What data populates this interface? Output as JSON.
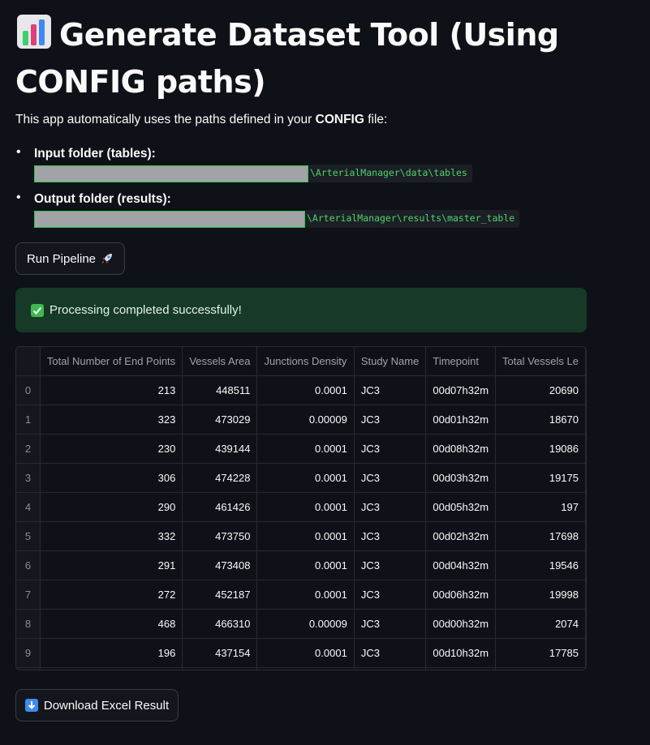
{
  "title": "Generate Dataset Tool (Using CONFIG paths)",
  "intro": {
    "prefix": "This app automatically uses the paths defined in your ",
    "bold": "CONFIG",
    "suffix": " file:"
  },
  "paths": [
    {
      "label": "Input folder (tables):",
      "suffix": "\\ArterialManager\\data\\tables"
    },
    {
      "label": "Output folder (results):",
      "suffix": "\\ArterialManager\\results\\master_table"
    }
  ],
  "run_button": "Run Pipeline",
  "success_message": "Processing completed successfully!",
  "table": {
    "columns": [
      "Total Number of End Points",
      "Vessels Area",
      "Junctions Density",
      "Study Name",
      "Timepoint",
      "Total Vessels Le"
    ],
    "rows": [
      {
        "idx": "0",
        "end_points": "213",
        "area": "448511",
        "density": "0.0001",
        "study": "JC3",
        "timepoint": "00d07h32m",
        "length": "20690"
      },
      {
        "idx": "1",
        "end_points": "323",
        "area": "473029",
        "density": "0.00009",
        "study": "JC3",
        "timepoint": "00d01h32m",
        "length": "18670"
      },
      {
        "idx": "2",
        "end_points": "230",
        "area": "439144",
        "density": "0.0001",
        "study": "JC3",
        "timepoint": "00d08h32m",
        "length": "19086"
      },
      {
        "idx": "3",
        "end_points": "306",
        "area": "474228",
        "density": "0.0001",
        "study": "JC3",
        "timepoint": "00d03h32m",
        "length": "19175"
      },
      {
        "idx": "4",
        "end_points": "290",
        "area": "461426",
        "density": "0.0001",
        "study": "JC3",
        "timepoint": "00d05h32m",
        "length": "197"
      },
      {
        "idx": "5",
        "end_points": "332",
        "area": "473750",
        "density": "0.0001",
        "study": "JC3",
        "timepoint": "00d02h32m",
        "length": "17698"
      },
      {
        "idx": "6",
        "end_points": "291",
        "area": "473408",
        "density": "0.0001",
        "study": "JC3",
        "timepoint": "00d04h32m",
        "length": "19546"
      },
      {
        "idx": "7",
        "end_points": "272",
        "area": "452187",
        "density": "0.0001",
        "study": "JC3",
        "timepoint": "00d06h32m",
        "length": "19998"
      },
      {
        "idx": "8",
        "end_points": "468",
        "area": "466310",
        "density": "0.00009",
        "study": "JC3",
        "timepoint": "00d00h32m",
        "length": "2074"
      },
      {
        "idx": "9",
        "end_points": "196",
        "area": "437154",
        "density": "0.0001",
        "study": "JC3",
        "timepoint": "00d10h32m",
        "length": "17785"
      }
    ]
  },
  "download_button": "Download Excel Result",
  "icons": {
    "title": "bar-chart-icon",
    "run": "rocket-icon",
    "success": "check-mark-icon",
    "download": "down-arrow-icon"
  },
  "colors": {
    "background": "#0e1117",
    "success_bg": "#173928",
    "code_text": "#4cd469",
    "redaction_border": "#2ec74a"
  }
}
